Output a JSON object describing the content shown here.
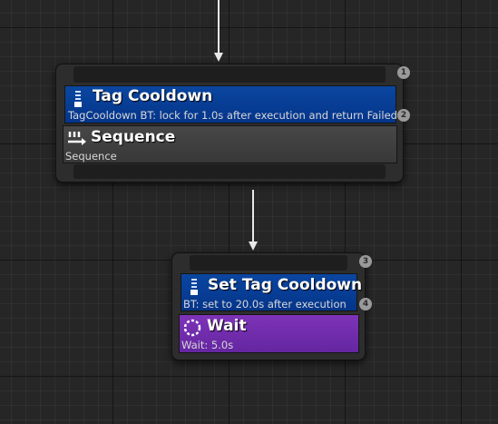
{
  "nodes": [
    {
      "index": "1",
      "decorator": {
        "title": "Tag Cooldown",
        "description": "TagCooldown BT: lock for 1.0s after execution and return Failed",
        "index": "2",
        "icon": "decorator-icon"
      },
      "composite": {
        "title": "Sequence",
        "description": "Sequence",
        "icon": "sequence-icon"
      }
    },
    {
      "index": "3",
      "decorator": {
        "title": "Set Tag Cooldown",
        "description": "BT: set to 20.0s after execution",
        "index": "4",
        "icon": "decorator-icon"
      },
      "task": {
        "title": "Wait",
        "description": "Wait: 5.0s",
        "icon": "wait-icon"
      }
    }
  ],
  "colors": {
    "decorator": "#0a46a0",
    "composite": "#404040",
    "task": "#7530b0",
    "wire": "#e8e8e8"
  }
}
